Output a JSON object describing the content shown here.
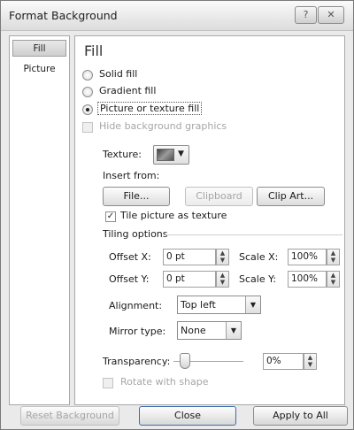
{
  "window": {
    "title": "Format Background",
    "help_label": "?",
    "close_label": "✕"
  },
  "nav": {
    "items": [
      {
        "label": "Fill"
      },
      {
        "label": "Picture"
      }
    ]
  },
  "fill": {
    "title": "Fill",
    "options": [
      {
        "label": "Solid fill",
        "selected": false
      },
      {
        "label": "Gradient fill",
        "selected": false
      },
      {
        "label": "Picture or texture fill",
        "selected": true
      }
    ],
    "hide_background_graphics": {
      "label": "Hide background graphics",
      "checked": false,
      "enabled": false
    },
    "texture_label": "Texture:",
    "texture_icon": "texture-swatch-icon",
    "insert_from_label": "Insert from:",
    "insert_buttons": {
      "file": "File...",
      "clipboard": "Clipboard",
      "clip_art": "Clip Art..."
    },
    "tile_as_texture": {
      "label": "Tile picture as texture",
      "checked": true
    },
    "tiling_options_label": "Tiling options",
    "offset_x": {
      "label": "Offset X:",
      "value": "0 pt"
    },
    "offset_y": {
      "label": "Offset Y:",
      "value": "0 pt"
    },
    "scale_x": {
      "label": "Scale X:",
      "value": "100%"
    },
    "scale_y": {
      "label": "Scale Y:",
      "value": "100%"
    },
    "alignment": {
      "label": "Alignment:",
      "value": "Top left"
    },
    "mirror_type": {
      "label": "Mirror type:",
      "value": "None"
    },
    "transparency": {
      "label": "Transparency:",
      "value": "0%",
      "level": 0
    },
    "rotate_with_shape": {
      "label": "Rotate with shape",
      "checked": false,
      "enabled": false
    }
  },
  "footer": {
    "reset_background": "Reset Background",
    "close": "Close",
    "apply_to_all": "Apply to All"
  }
}
